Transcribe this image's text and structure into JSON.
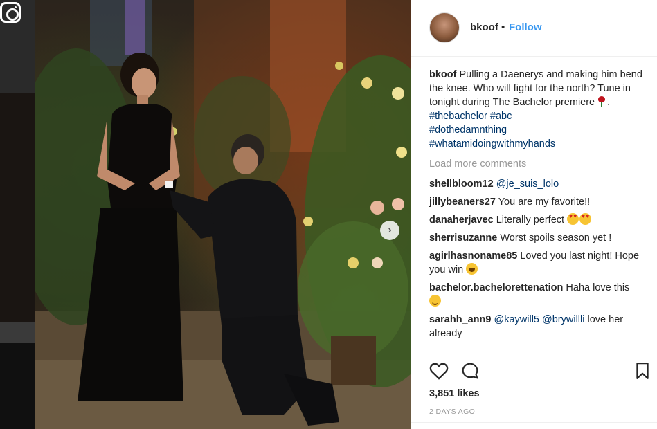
{
  "post": {
    "author": "bkoof",
    "separator": "•",
    "follow_label": "Follow",
    "caption_user": "bkoof",
    "caption_text": "Pulling a Daenerys and making him bend the knee. Who will fight for the north? Tune in tonight during The Bachelor premiere",
    "caption_tags": [
      "#thebachelor",
      "#abc",
      "#dothedamnthing",
      "#whatamidoingwithmyhands"
    ],
    "load_more": "Load more comments",
    "comments": [
      {
        "user": "shellbloom12",
        "text": "",
        "mention": "@je_suis_lolo"
      },
      {
        "user": "jillybeaners27",
        "text": "You are my favorite!!"
      },
      {
        "user": "danaherjavec",
        "text": "Literally perfect"
      },
      {
        "user": "sherrisuzanne",
        "text": "Worst spoils season yet !"
      },
      {
        "user": "agirlhasnoname85",
        "text": "Loved you last night! Hope you win"
      },
      {
        "user": "bachelor.bachelorettenation",
        "text": "Haha love this"
      },
      {
        "user": "sarahh_ann9",
        "mention1": "@kaywill5",
        "mention2": "@brywillli",
        "text": "love her already"
      }
    ],
    "likes": "3,851 likes",
    "timestamp": "2 DAYS AGO"
  },
  "icons": {
    "logo": "instagram-logo-icon",
    "next": "chevron-right-icon",
    "like": "heart-icon",
    "comment": "comment-bubble-icon",
    "save": "bookmark-icon"
  },
  "colors": {
    "link": "#3897f0",
    "hashtag": "#003569",
    "muted": "#999999",
    "text": "#262626"
  }
}
